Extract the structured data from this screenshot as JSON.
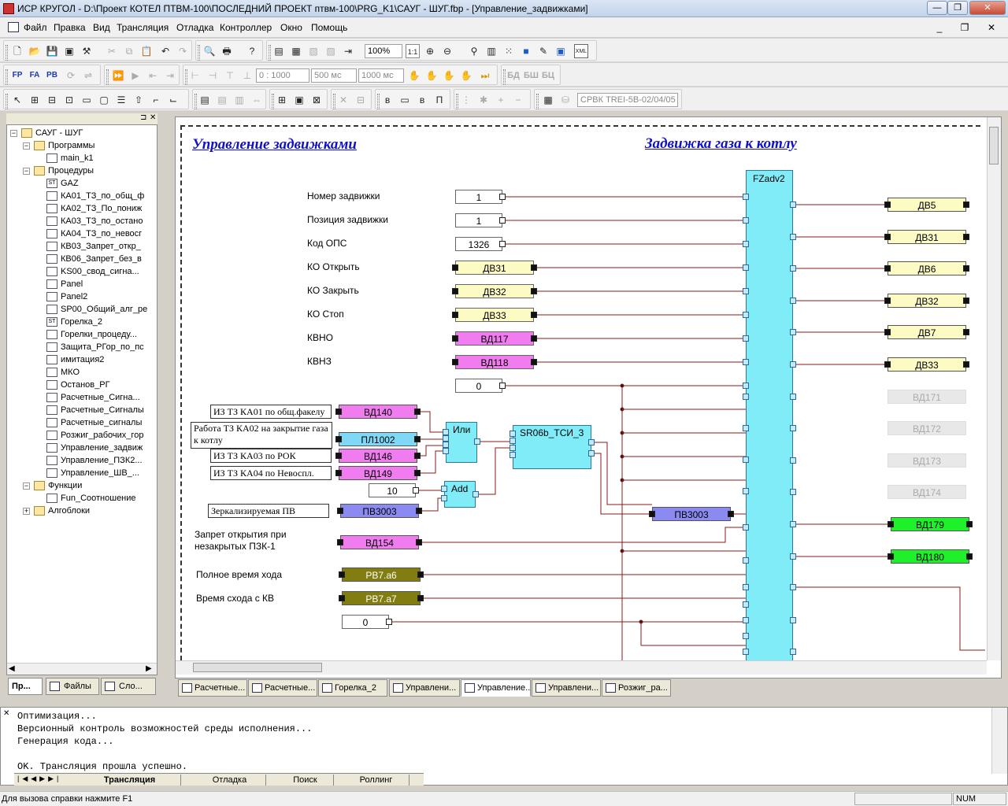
{
  "window": {
    "title": "ИСР КРУГОЛ - D:\\Проект КОТЕЛ ПТВМ-100\\ПОСЛЕДНИЙ ПРОЕКТ птвм-100\\PRG_K1\\САУГ - ШУГ.fbp - [Управление_задвижками]",
    "minimize": "—",
    "restore": "❐",
    "close": "✕"
  },
  "menu": {
    "items": [
      "Файл",
      "Правка",
      "Вид",
      "Трансляция",
      "Отладка",
      "Контроллер",
      "Окно",
      "Помощь"
    ],
    "mdi_minimize": "_",
    "mdi_restore": "❐",
    "mdi_close": "✕"
  },
  "toolbar1": {
    "zoom": "100%",
    "zoom_one": "1:1",
    "xml": "XML"
  },
  "toolbar2": {
    "time_range": "0 : 1000",
    "step1": "500 мс",
    "step2": "1000 мс",
    "bd": "БД",
    "bsh": "БШ",
    "bc": "БЦ"
  },
  "toolbar3": {
    "controller": "СРВК TREI-5B-02/04/05"
  },
  "tree": {
    "root": "САУГ - ШУГ",
    "programs": "Программы",
    "program_items": [
      "main_k1"
    ],
    "procedures": "Процедуры",
    "procedure_items": [
      "GAZ",
      "КА01_ТЗ_по_общ_ф",
      "КА02_ТЗ_По_пониж",
      "КА03_ТЗ_по_остано",
      "КА04_ТЗ_по_невосг",
      "КВ03_Запрет_откр_",
      "КВ06_Запрет_без_в",
      "KS00_свод_сигна...",
      "Panel",
      "Panel2",
      "SP00_Общий_алг_ре",
      "Горелка_2",
      "Горелки_процеду...",
      "Защита_РГор_по_пс",
      "имитация2",
      "МКО",
      "Останов_РГ",
      "Расчетные_Сигна...",
      "Расчетные_Сигналы",
      "Расчетные_сигналы",
      "Розжиг_рабочих_гор",
      "Управление_задвиж",
      "Управление_ПЗК2...",
      "Управление_ШВ_..."
    ],
    "functions": "Функции",
    "function_items": [
      "Fun_Соотношение"
    ],
    "algoblocks": "Алгоблоки"
  },
  "left_tabs": [
    "Пр...",
    "Файлы",
    "Сло..."
  ],
  "diagram": {
    "title_left": "Управление задвижками",
    "title_right": "Задвижка газа к котлу",
    "main_block": "FZadv2",
    "input_labels": [
      "Номер задвижки",
      "Позиция задвижки",
      "Код ОПС",
      "КО Открыть",
      "КО Закрыть",
      "КО Стоп",
      "КВНО",
      "КВНЗ"
    ],
    "input_values": [
      "1",
      "1",
      "1326",
      "ДВ31",
      "ДВ32",
      "ДВ33",
      "ВД117",
      "ВД118",
      "0"
    ],
    "comments": [
      "ИЗ ТЗ КА01 по общ.факелу",
      "Работа ТЗ КА02 на закрытие газа к котлу",
      "ИЗ ТЗ КА03 по РОК",
      "ИЗ ТЗ КА04 по Невоспл.",
      "Зеркализируемая ПВ"
    ],
    "signals": [
      "ВД140",
      "ПЛ1002",
      "ВД146",
      "ВД149",
      "ПВ3003",
      "ВД154",
      "РВ7.а6",
      "РВ7.а7"
    ],
    "const_10": "10",
    "const_0b": "0",
    "or_block": "Или",
    "add_block": "Add",
    "sr_block": "SR06b_ТСИ_3",
    "pv_out": "ПВ3003",
    "label_zapret": "Запрет открытия при незакрытых ПЗК-1",
    "label_full_time": "Полное время хода",
    "label_time_kv": "Время схода с КВ",
    "outputs": [
      "ДВ5",
      "ДВ31",
      "ДВ6",
      "ДВ32",
      "ДВ7",
      "ДВ33",
      "ВД171",
      "ВД172",
      "ВД173",
      "ВД174",
      "ВД179",
      "ВД180"
    ],
    "colors": {
      "yellow": "#fdfbc4",
      "magenta": "#f07cf0",
      "cyan": "#80ecf8",
      "blue": "#8a8af2",
      "olive": "#827d10",
      "green": "#1ef02a",
      "gray": "#e8e8e8",
      "wire": "#8b1a1a"
    }
  },
  "doc_tabs": [
    "Расчетные...",
    "Расчетные...",
    "Горелка_2",
    "Управлени...",
    "Управление...",
    "Управлени...",
    "Розжиг_ра..."
  ],
  "output": {
    "lines": [
      "Оптимизация...",
      "Версионный контроль возможностей среды исполнения...",
      "Генерация кода...",
      "",
      "OK. Трансляция прошла успешно."
    ],
    "tabs": [
      "Трансляция",
      "Отладка",
      "Поиск",
      "Роллинг"
    ]
  },
  "status": {
    "help": "Для вызова справки нажмите F1",
    "num": "NUM"
  }
}
